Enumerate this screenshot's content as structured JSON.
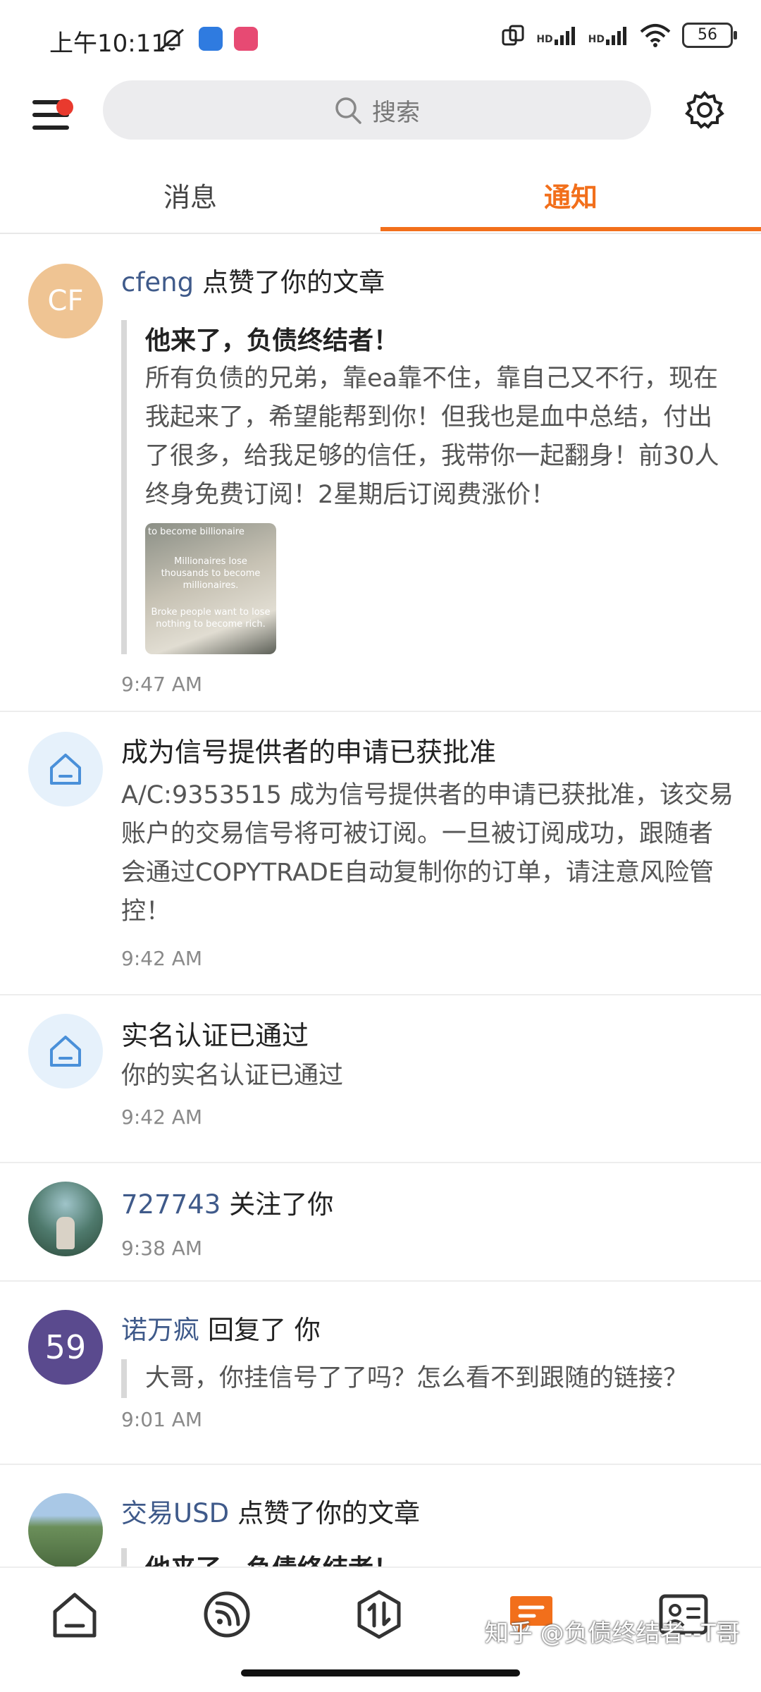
{
  "status_bar": {
    "time": "上午10:11",
    "hd1": "HD",
    "hd2": "HD",
    "battery": "56"
  },
  "header": {
    "search_placeholder": "搜索"
  },
  "tabs": [
    {
      "label": "消息"
    },
    {
      "label": "通知"
    }
  ],
  "notifications": [
    {
      "avatar_text": "CF",
      "user": "cfeng",
      "action": "点赞了你的文章",
      "quote_title": "他来了，负债终结者！",
      "quote_body": "所有负债的兄弟，靠ea靠不住，靠自己又不行，现在我起来了，希望能帮到你！但我也是血中总结，付出了很多，给我足够的信任，我带你一起翻身！前30人终身免费订阅！2星期后订阅费涨价！",
      "thumb_text_1": "to become billionaire",
      "thumb_text_2": "Millionaires lose thousands to become millionaires.",
      "thumb_text_3": "Broke people want to lose nothing to become rich.",
      "time": "9:47 AM"
    },
    {
      "title": "成为信号提供者的申请已获批准",
      "body": "A/C:9353515 成为信号提供者的申请已获批准，该交易账户的交易信号将可被订阅。一旦被订阅成功，跟随者会通过COPYTRADE自动复制你的订单，请注意风险管控！",
      "time": "9:42 AM"
    },
    {
      "title": "实名认证已通过",
      "body": "你的实名认证已通过",
      "time": "9:42 AM"
    },
    {
      "user": "727743",
      "action": "关注了你",
      "time": "9:38 AM"
    },
    {
      "avatar_text": "59",
      "user": "诺万疯",
      "action": "回复了 你",
      "quote_body": "大哥，你挂信号了了吗？怎么看不到跟随的链接？",
      "time": "9:01 AM"
    },
    {
      "user": "交易USD",
      "action": "点赞了你的文章",
      "quote_title": "他来了，负债终结者！"
    }
  ],
  "watermark": "知乎 @负债终结者--T哥",
  "colors": {
    "accent": "#f26f1b",
    "username": "#3f5a8a",
    "badge": "#e93a2e"
  }
}
